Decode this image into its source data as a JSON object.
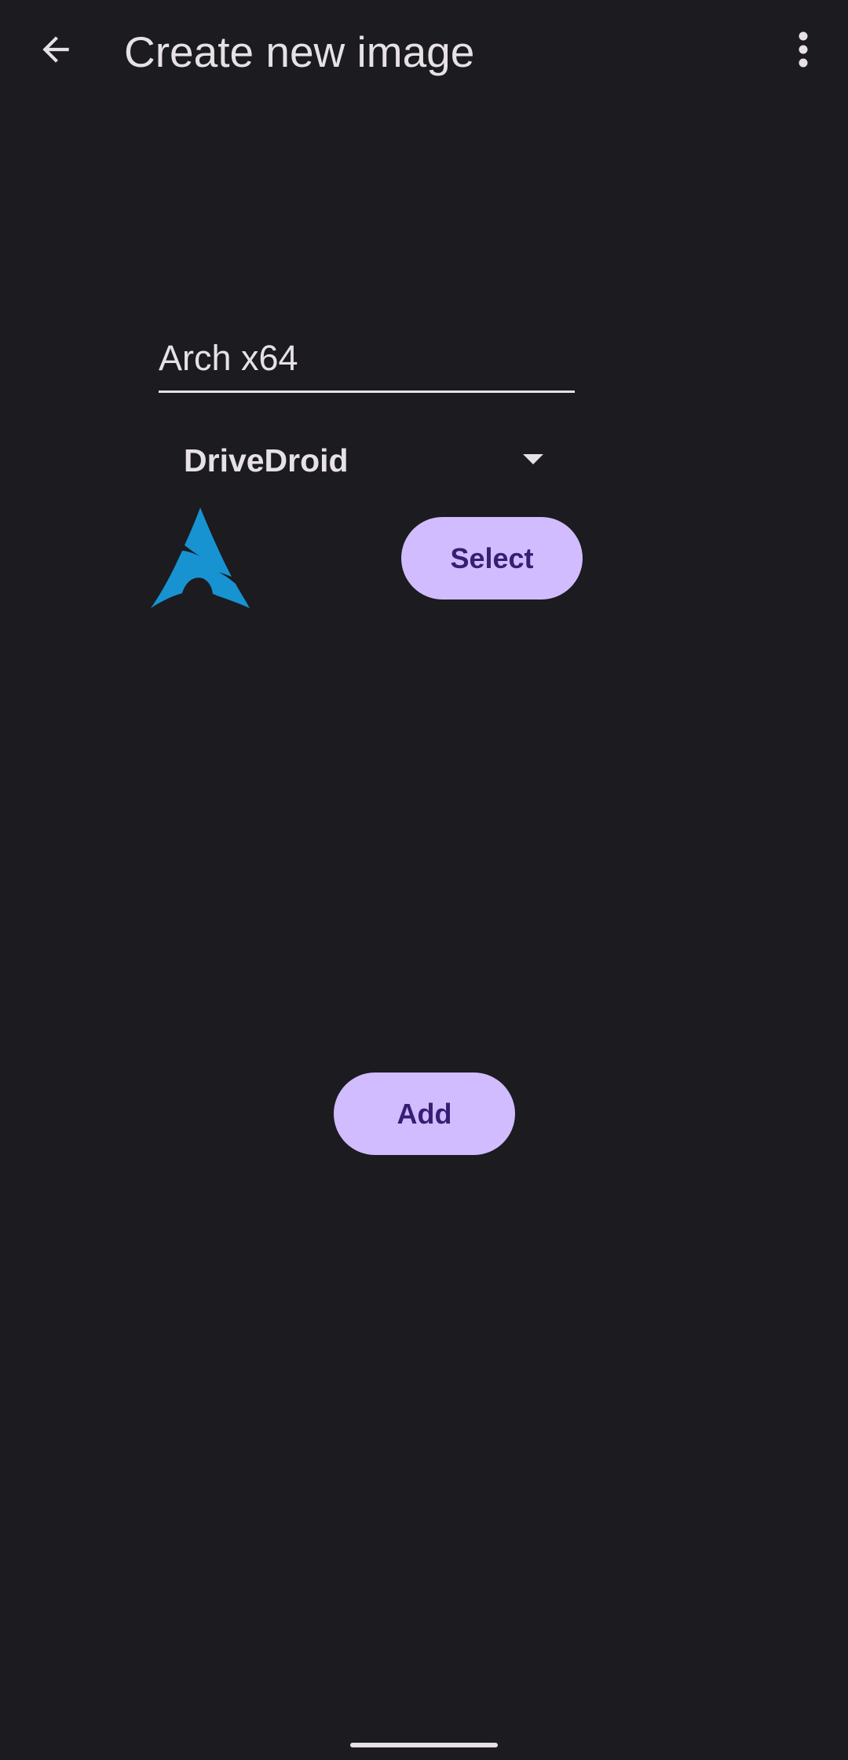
{
  "app_bar": {
    "back_icon": "arrow-back-icon",
    "title": "Create new image",
    "menu_icon": "more-vert-icon"
  },
  "form": {
    "name_value": "Arch x64",
    "source_selected": "DriveDroid",
    "source_dropdown_icon": "dropdown-arrow-icon",
    "logo_icon": "arch-linux-logo",
    "select_label": "Select",
    "add_label": "Add"
  },
  "colors": {
    "background": "#1c1b1f",
    "on_surface": "#e6e1e5",
    "primary_container": "#d0bcff",
    "on_primary_container": "#381e72",
    "logo_blue": "#1793d1"
  }
}
